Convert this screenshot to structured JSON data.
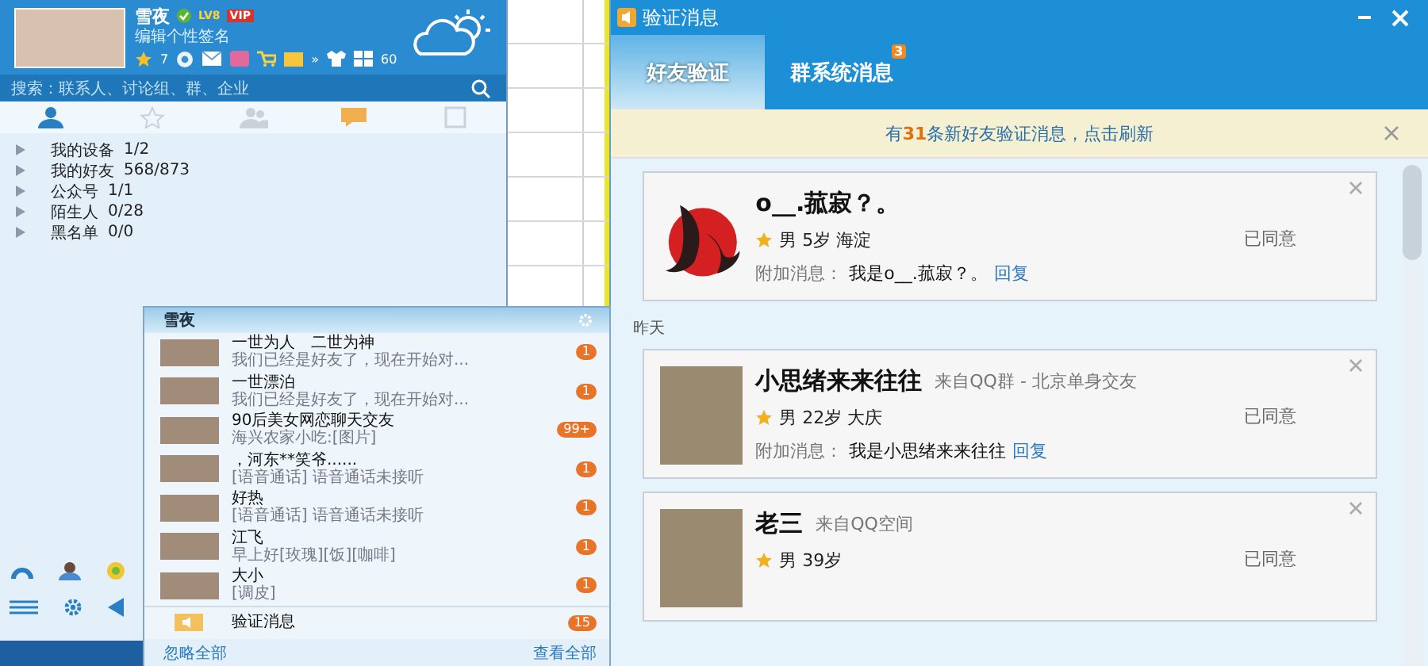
{
  "profile": {
    "name": "雪夜",
    "signature": "编辑个性签名",
    "level_badge": "LV8",
    "vip_badge": "VIP",
    "star_count": "7",
    "more": "»",
    "points": "60"
  },
  "search": {
    "placeholder": "搜索：联系人、讨论组、群、企业"
  },
  "contact_tabs": [
    {
      "kind": "contacts",
      "selected": true
    },
    {
      "kind": "favorites",
      "selected": false
    },
    {
      "kind": "groups",
      "selected": false
    },
    {
      "kind": "chats",
      "selected": false
    },
    {
      "kind": "apps",
      "selected": false
    }
  ],
  "contact_groups": [
    {
      "name": "我的设备",
      "count": "1/2"
    },
    {
      "name": "我的好友",
      "count": "568/873"
    },
    {
      "name": "公众号",
      "count": "1/1"
    },
    {
      "name": "陌生人",
      "count": "0/28"
    },
    {
      "name": "黑名单",
      "count": "0/0"
    }
  ],
  "popup": {
    "title": "雪夜",
    "items": [
      {
        "name": "一世为人　二世为神",
        "preview": "我们已经是好友了，现在开始对...",
        "badge": "1"
      },
      {
        "name": "一世漂泊",
        "preview": "我们已经是好友了，现在开始对...",
        "badge": "1"
      },
      {
        "name": "90后美女网恋聊天交友",
        "preview": "海兴农家小吃:[图片]",
        "badge": "99+"
      },
      {
        "name": "，河东**笑爷......",
        "preview": "[语音通话] 语音通话未接听",
        "badge": "1"
      },
      {
        "name": "好热",
        "preview": "[语音通话] 语音通话未接听",
        "badge": "1"
      },
      {
        "name": "江飞",
        "preview": "早上好[玫瑰][饭][咖啡]",
        "badge": "1"
      },
      {
        "name": "大小",
        "preview": "[调皮]",
        "badge": "1"
      }
    ],
    "verify": {
      "label": "验证消息",
      "badge": "15"
    },
    "ignore_all": "忽略全部",
    "view_all": "查看全部"
  },
  "dialog": {
    "title": "验证消息",
    "tabs": [
      {
        "label": "好友验证",
        "selected": true
      },
      {
        "label": "群系统消息",
        "selected": false,
        "badge": "3"
      }
    ],
    "notice": "有**31**条新好友验证消息，点击刷新",
    "sections": [
      {
        "requests": [
          {
            "kind": "logo",
            "name": "o__.菰寂？。",
            "info": "男 5岁 海淀",
            "extra_label": "附加消息：",
            "extra": "我是o__.菰寂？。",
            "reply": "回复",
            "status": "已同意"
          }
        ]
      },
      {
        "heading": "昨天",
        "requests": [
          {
            "kind": "photo",
            "name": "小思绪来来往往",
            "source": "来自QQ群 - 北京单身交友",
            "info": "男 22岁 大庆",
            "extra_label": "附加消息：",
            "extra": "我是小思绪来来往往",
            "reply": "回复",
            "status": "已同意"
          },
          {
            "kind": "photo",
            "name": "老三",
            "source": "来自QQ空间",
            "info": "男 39岁",
            "status": "已同意"
          }
        ]
      }
    ]
  }
}
